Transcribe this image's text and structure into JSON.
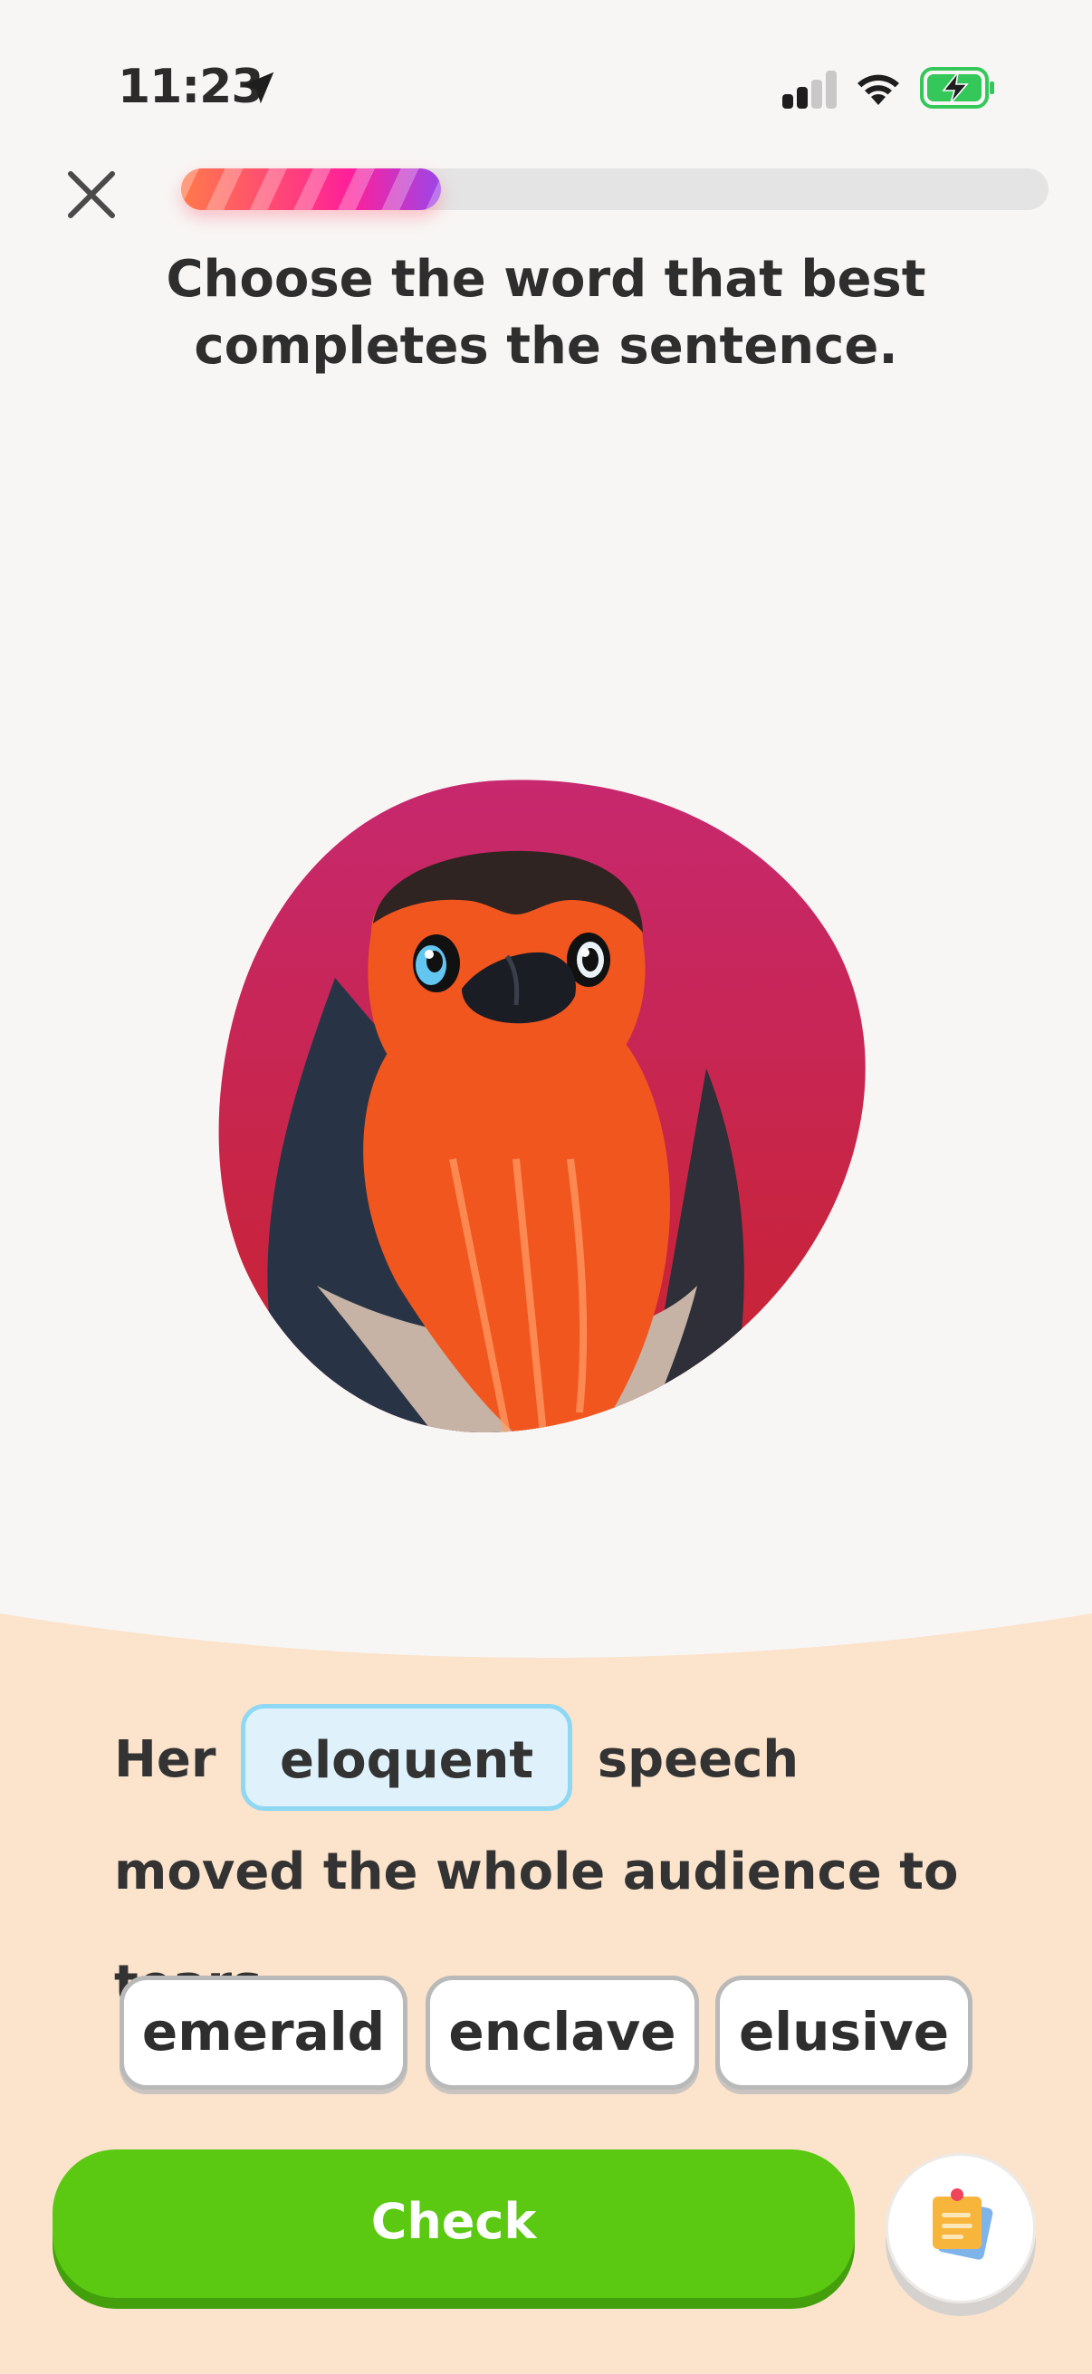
{
  "status_bar": {
    "time": "11:23",
    "icons": [
      "location-arrow-icon",
      "cellular-signal-icon",
      "wifi-icon",
      "battery-charging-icon"
    ]
  },
  "header": {
    "close_icon": "close-icon",
    "progress_fraction": 0.3
  },
  "prompt": "Choose the word that best completes the sentence.",
  "illustration": {
    "subject": "bird-illustration",
    "blob_colors": [
      "#c7286e",
      "#c8232e"
    ]
  },
  "sentence": {
    "before": "Her",
    "filled_word": "eloquent",
    "after": "speech moved the whole audience to tears."
  },
  "choices": [
    "emerald",
    "enclave",
    "elusive"
  ],
  "actions": {
    "check_label": "Check",
    "notes_icon": "notes-icon"
  },
  "colors": {
    "background": "#f8f6f5",
    "sheet": "#fbe3cc",
    "check_green": "#5bc812",
    "selected_border": "#8fd8f3",
    "selected_fill": "#dff2fb"
  }
}
